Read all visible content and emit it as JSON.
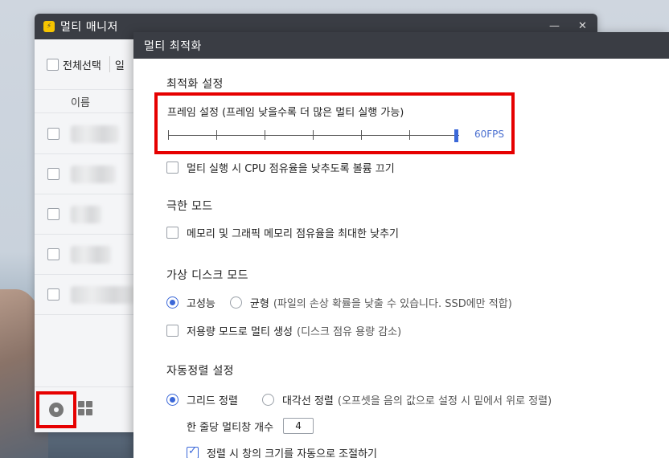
{
  "manager": {
    "title": "멀티 매니저",
    "logo_glyph": "⚡",
    "minimize": "—",
    "close": "✕",
    "select_all": "전체선택",
    "truncated_button": "일",
    "column_name": "이름"
  },
  "dialog": {
    "title": "멀티 최적화",
    "optimization": {
      "title": "최적화 설정",
      "frame_label": "프레임 설정 (프레임 낮을수록 더 많은 멀티 실행 가능)",
      "fps_value": "60FPS",
      "fps_fraction": 1.0,
      "cpu_option": "멀티 실행 시 CPU 점유율을 낮추도록 볼륨 끄기"
    },
    "extreme": {
      "title": "극한 모드",
      "memory_option": "메모리 및 그래픽 메모리 점유율을 최대한 낮추기"
    },
    "virtual_disk": {
      "title": "가상 디스크 모드",
      "high_performance": "고성능",
      "balanced": "균형",
      "balanced_note": "(파일의 손상 확률을 낮출 수 있습니다. SSD에만 적합)",
      "low_capacity": "저용량 모드로 멀티 생성",
      "low_capacity_note": "(디스크 점유 용량 감소)"
    },
    "auto_arrange": {
      "title": "자동정렬 설정",
      "grid": "그리드 정렬",
      "diagonal": "대각선 정렬",
      "diagonal_note": "(오프셋을 음의 값으로 설정 시 밑에서 위로 정렬)",
      "per_row_label": "한 줄당 멀티창 개수",
      "per_row_value": "4",
      "auto_size": "정렬 시 창의 크기를 자동으로 조절하기"
    }
  },
  "colors": {
    "accent": "#3b68d8",
    "highlight": "#e60000",
    "titlebar": "#3a3d44"
  }
}
